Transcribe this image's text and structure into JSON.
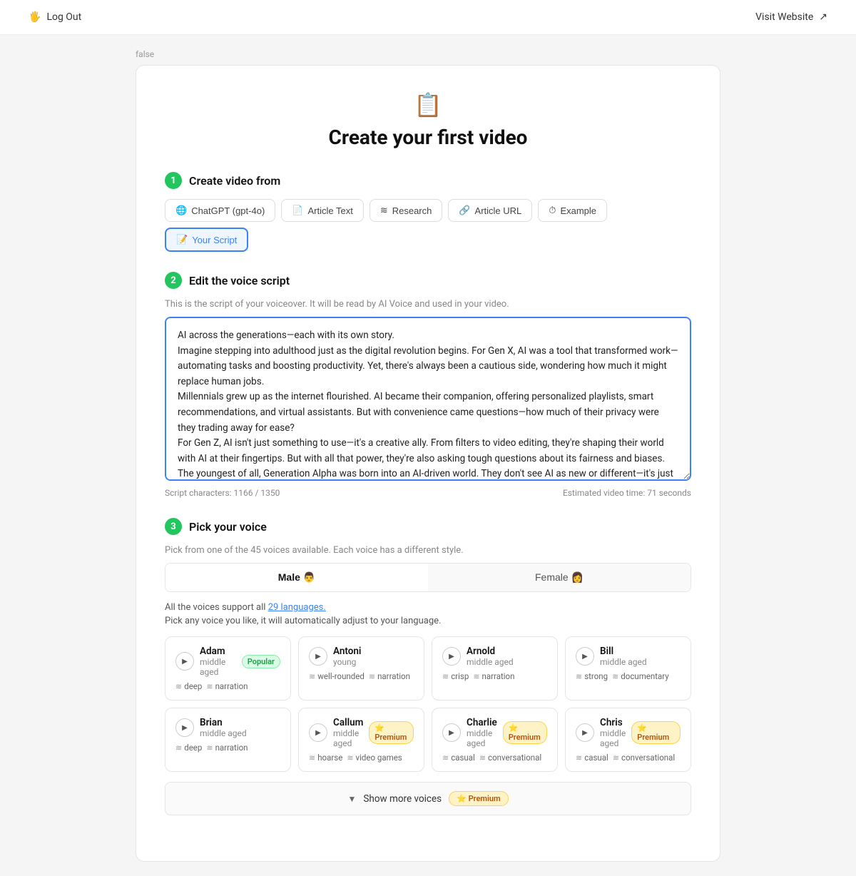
{
  "topbar": {
    "logout_label": "Log Out",
    "logout_icon": "🖐",
    "visit_label": "Visit Website",
    "visit_icon": "↗"
  },
  "badge": "false",
  "page": {
    "icon": "📋",
    "title": "Create your first video"
  },
  "step1": {
    "number": "1",
    "title": "Create video from",
    "tabs": [
      {
        "id": "chatgpt",
        "icon": "🌐",
        "label": "ChatGPT (gpt-4o)",
        "active": false
      },
      {
        "id": "article-text",
        "icon": "📄",
        "label": "Article Text",
        "active": false
      },
      {
        "id": "research",
        "icon": "≋",
        "label": "Research",
        "active": false
      },
      {
        "id": "article-url",
        "icon": "🔗",
        "label": "Article URL",
        "active": false
      },
      {
        "id": "example",
        "icon": "⏱",
        "label": "Example",
        "active": false
      },
      {
        "id": "your-script",
        "icon": "📝",
        "label": "Your Script",
        "active": true
      }
    ]
  },
  "step2": {
    "number": "2",
    "title": "Edit the voice script",
    "subtitle": "This is the script of your voiceover. It will be read by AI Voice and used in your video.",
    "script": "AI across the generations—each with its own story.\nImagine stepping into adulthood just as the digital revolution begins. For Gen X, AI was a tool that transformed work—automating tasks and boosting productivity. Yet, there's always been a cautious side, wondering how much it might replace human jobs.\nMillennials grew up as the internet flourished. AI became their companion, offering personalized playlists, smart recommendations, and virtual assistants. But with convenience came questions—how much of their privacy were they trading away for ease?\nFor Gen Z, AI isn't just something to use—it's a creative ally. From filters to video editing, they're shaping their world with AI at their fingertips. But with all that power, they're also asking tough questions about its fairness and biases.\nThe youngest of all, Generation Alpha was born into an AI-driven world. They don't see AI as new or different—it's just part of their everyday lives, from learning to play. As they grow, they'll be the ones to face AI's challenges head-on.\nEvery generation has its unique relationship with AI, but one thing is certain—it's here to stay, and its future is in our hands.",
    "chars_label": "Script characters: 1166 / 1350",
    "time_label": "Estimated video time: 71 seconds"
  },
  "step3": {
    "number": "3",
    "title": "Pick your voice",
    "subtitle": "Pick from one of the 45 voices available. Each voice has a different style.",
    "voice_tabs": [
      {
        "id": "male",
        "label": "Male 👨",
        "active": true
      },
      {
        "id": "female",
        "label": "Female 👩",
        "active": false
      }
    ],
    "language_note": "All the voices support all",
    "language_link": "29 languages.",
    "language_note2": "Pick any voice you like, it will automatically adjust to your language.",
    "voices": [
      {
        "id": "adam",
        "name": "Adam",
        "age": "middle aged",
        "tags": [
          "deep",
          "narration"
        ],
        "badge": "popular",
        "badge_label": "Popular"
      },
      {
        "id": "antoni",
        "name": "Antoni",
        "age": "young",
        "tags": [
          "well-rounded",
          "narration"
        ],
        "badge": null
      },
      {
        "id": "arnold",
        "name": "Arnold",
        "age": "middle aged",
        "tags": [
          "crisp",
          "narration"
        ],
        "badge": null
      },
      {
        "id": "bill",
        "name": "Bill",
        "age": "middle aged",
        "tags": [
          "strong",
          "documentary"
        ],
        "badge": null
      },
      {
        "id": "brian",
        "name": "Brian",
        "age": "middle aged",
        "tags": [
          "deep",
          "narration"
        ],
        "badge": null
      },
      {
        "id": "callum",
        "name": "Callum",
        "age": "middle aged",
        "tags": [
          "hoarse",
          "video games"
        ],
        "badge": "premium",
        "badge_label": "Premium"
      },
      {
        "id": "charlie",
        "name": "Charlie",
        "age": "middle aged",
        "tags": [
          "casual",
          "conversational"
        ],
        "badge": "premium",
        "badge_label": "Premium"
      },
      {
        "id": "chris",
        "name": "Chris",
        "age": "middle aged",
        "tags": [
          "casual",
          "conversational"
        ],
        "badge": "premium",
        "badge_label": "Premium"
      }
    ],
    "show_more": "Show more voices",
    "show_more_badge": "Premium"
  }
}
